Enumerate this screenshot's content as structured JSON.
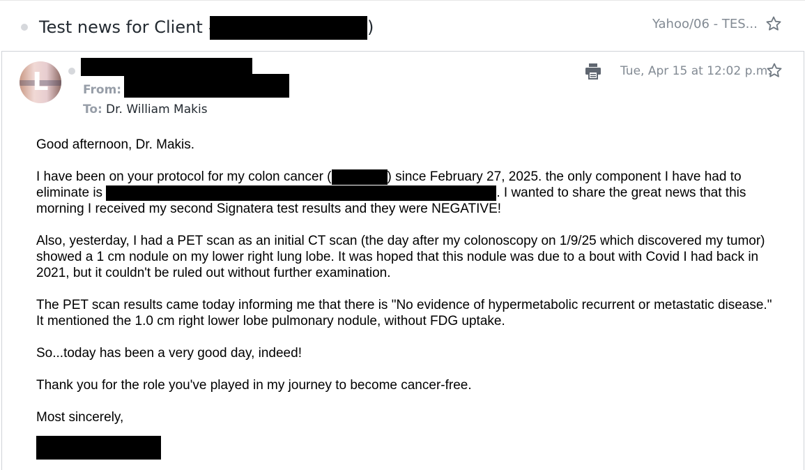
{
  "header": {
    "subject_prefix": "Test news for Client #",
    "subject_suffix": ")",
    "folder": "Yahoo/06 - TES..."
  },
  "message": {
    "avatar_letter": "L",
    "from_label": "From:",
    "to_label": "To:",
    "to_value": "Dr. William Makis",
    "date": "Tue, Apr 15 at 12:02 p.m."
  },
  "body": {
    "greeting": "Good afternoon, Dr. Makis.",
    "p1_a": "I have been on your protocol for my colon cancer (",
    "p1_b": ") since February 27, 2025. the only component I have had to eliminate is",
    "p1_c": ". I wanted to share the great news that this morning I received my second Signatera test results and they were NEGATIVE!",
    "p2": "Also, yesterday, I had a PET scan as an initial CT scan (the day after my colonoscopy on 1/9/25 which discovered my tumor) showed a 1 cm nodule on my lower right lung lobe. It was hoped that this nodule was due to a bout with Covid I had back in 2021, but it couldn't be ruled out without further examination.",
    "p3": "The PET scan results came today informing me that there is \"No evidence of hypermetabolic recurrent or metastatic disease.\" It mentioned the 1.0 cm right lower lobe pulmonary nodule, without FDG uptake.",
    "p4": "So...today has been a very good day, indeed!",
    "p5": "Thank you for the role you've played in my journey to become cancer-free.",
    "closing": "Most sincerely,"
  },
  "colors": {
    "muted": "#828a93",
    "label": "#979ea8",
    "text": "#232a31",
    "redaction": "#000000"
  },
  "icons": {
    "star": "star-icon",
    "print": "print-icon"
  }
}
